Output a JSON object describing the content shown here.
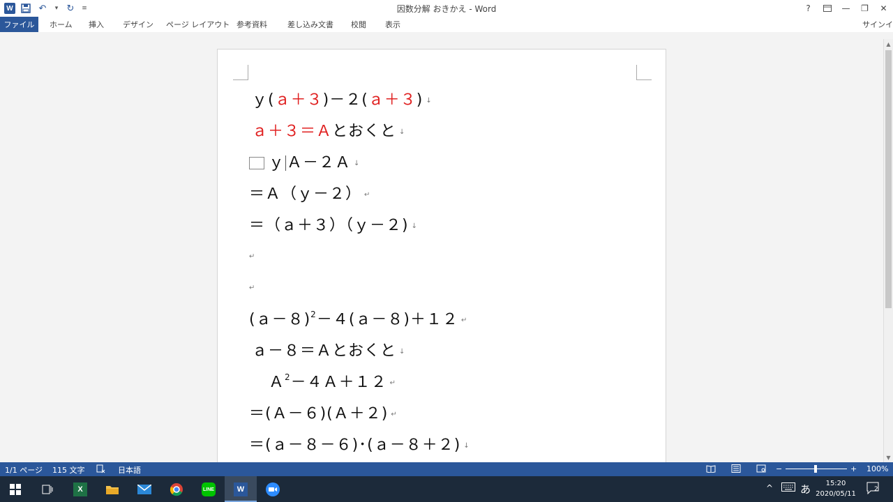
{
  "titlebar": {
    "title": "因数分解 おきかえ - Word",
    "help": "?",
    "minimize": "—",
    "restore": "❐",
    "close": "✕"
  },
  "ribbon": {
    "tabs": [
      "ファイル",
      "ホーム",
      "挿入",
      "デザイン",
      "ページ レイアウト",
      "参考資料",
      "差し込み文書",
      "校閲",
      "表示"
    ],
    "signin": "サインイン"
  },
  "document": {
    "lines": [
      {
        "id": "l1"
      },
      {
        "id": "l2"
      },
      {
        "id": "l3"
      },
      {
        "id": "l4",
        "text": "＝Ａ（ｙ－２）"
      },
      {
        "id": "l5",
        "text": "＝（ａ＋３）（ｙ－２)"
      },
      {
        "id": "l8",
        "text": "(ａ－８)"
      },
      {
        "id": "l9",
        "text": "ａ－８＝Ａとおくと"
      },
      {
        "id": "l10",
        "text": "Ａ"
      },
      {
        "id": "l11",
        "text": "＝(Ａ－６)(Ａ＋２)"
      },
      {
        "id": "l12",
        "text": "＝(ａ－８－６)･(ａ－８＋２)"
      }
    ],
    "parts": {
      "l1a": "ｙ(",
      "l1b": "ａ＋３",
      "l1c": ")－２(",
      "l1d": "ａ＋３",
      "l1e": ")",
      "l2a": "ａ＋３＝Ａ",
      "l2b": "とおくと",
      "l3a": "ｙ",
      "l3b": "Ａ－２Ａ",
      "l8sup": "2",
      "l8b": "－４(ａ－８)＋１２",
      "l10sup": "2",
      "l10b": "－４Ａ＋１２"
    }
  },
  "statusbar": {
    "page": "1/1 ページ",
    "words": "115 文字",
    "language": "日本語",
    "zoom": "100%"
  },
  "taskbar": {
    "time": "15:20",
    "date": "2020/05/11",
    "ime": "あ",
    "notifications": "2"
  }
}
